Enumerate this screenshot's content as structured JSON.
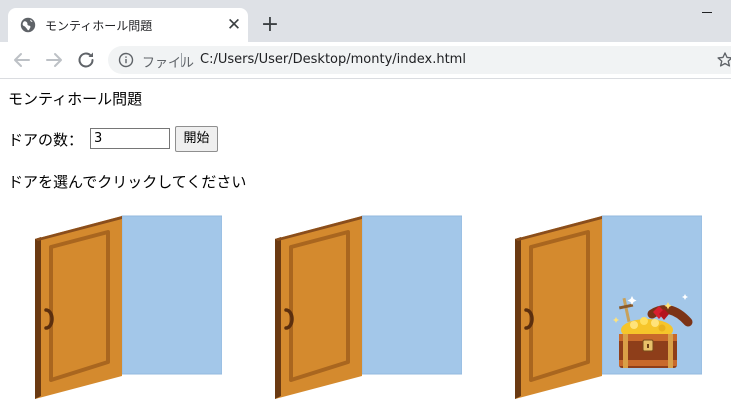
{
  "browser": {
    "tab": {
      "title": "モンティホール問題",
      "favicon": "globe-icon",
      "close_glyph": "✕"
    },
    "new_tab_glyph": "+",
    "toolbar": {
      "back_icon": "arrow-left-icon",
      "forward_icon": "arrow-right-icon",
      "reload_icon": "reload-icon",
      "info_icon": "info-icon",
      "scheme_label": "ファイル",
      "url": "C:/Users/User/Desktop/monty/index.html",
      "bookmark_icon": "star-icon"
    }
  },
  "page": {
    "heading": "モンティホール問題",
    "count_label": "ドアの数：",
    "count_value": "3",
    "start_button": "開始",
    "instruction": "ドアを選んでクリックしてください",
    "doors": [
      {
        "state": "open",
        "contents": "empty"
      },
      {
        "state": "open",
        "contents": "empty"
      },
      {
        "state": "open",
        "contents": "treasure-chest"
      }
    ],
    "colors": {
      "door_wood": "#d48a2e",
      "door_edge": "#6b3a12",
      "opening_sky": "#a3c7e9",
      "treasure_gold": "#f6c52a",
      "treasure_gem": "#d91f2e"
    }
  }
}
